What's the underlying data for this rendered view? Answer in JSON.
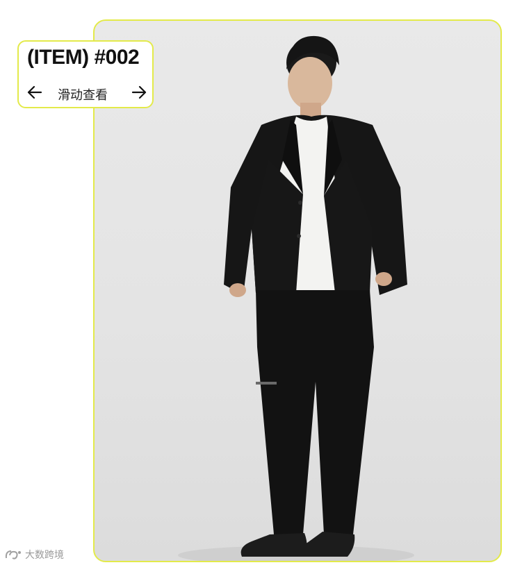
{
  "item_card": {
    "title": "(ITEM) #002",
    "swipe_hint": "滑动查看",
    "prev_icon": "arrow-left-icon",
    "next_icon": "arrow-right-icon"
  },
  "photo": {
    "subject": "model-full-body-icon"
  },
  "watermark": {
    "logo": "watermark-logo-icon",
    "text": "大数跨境"
  },
  "colors": {
    "accent_border": "#e3ea4a",
    "background": "#e6e6e6",
    "garment": "#111111"
  }
}
